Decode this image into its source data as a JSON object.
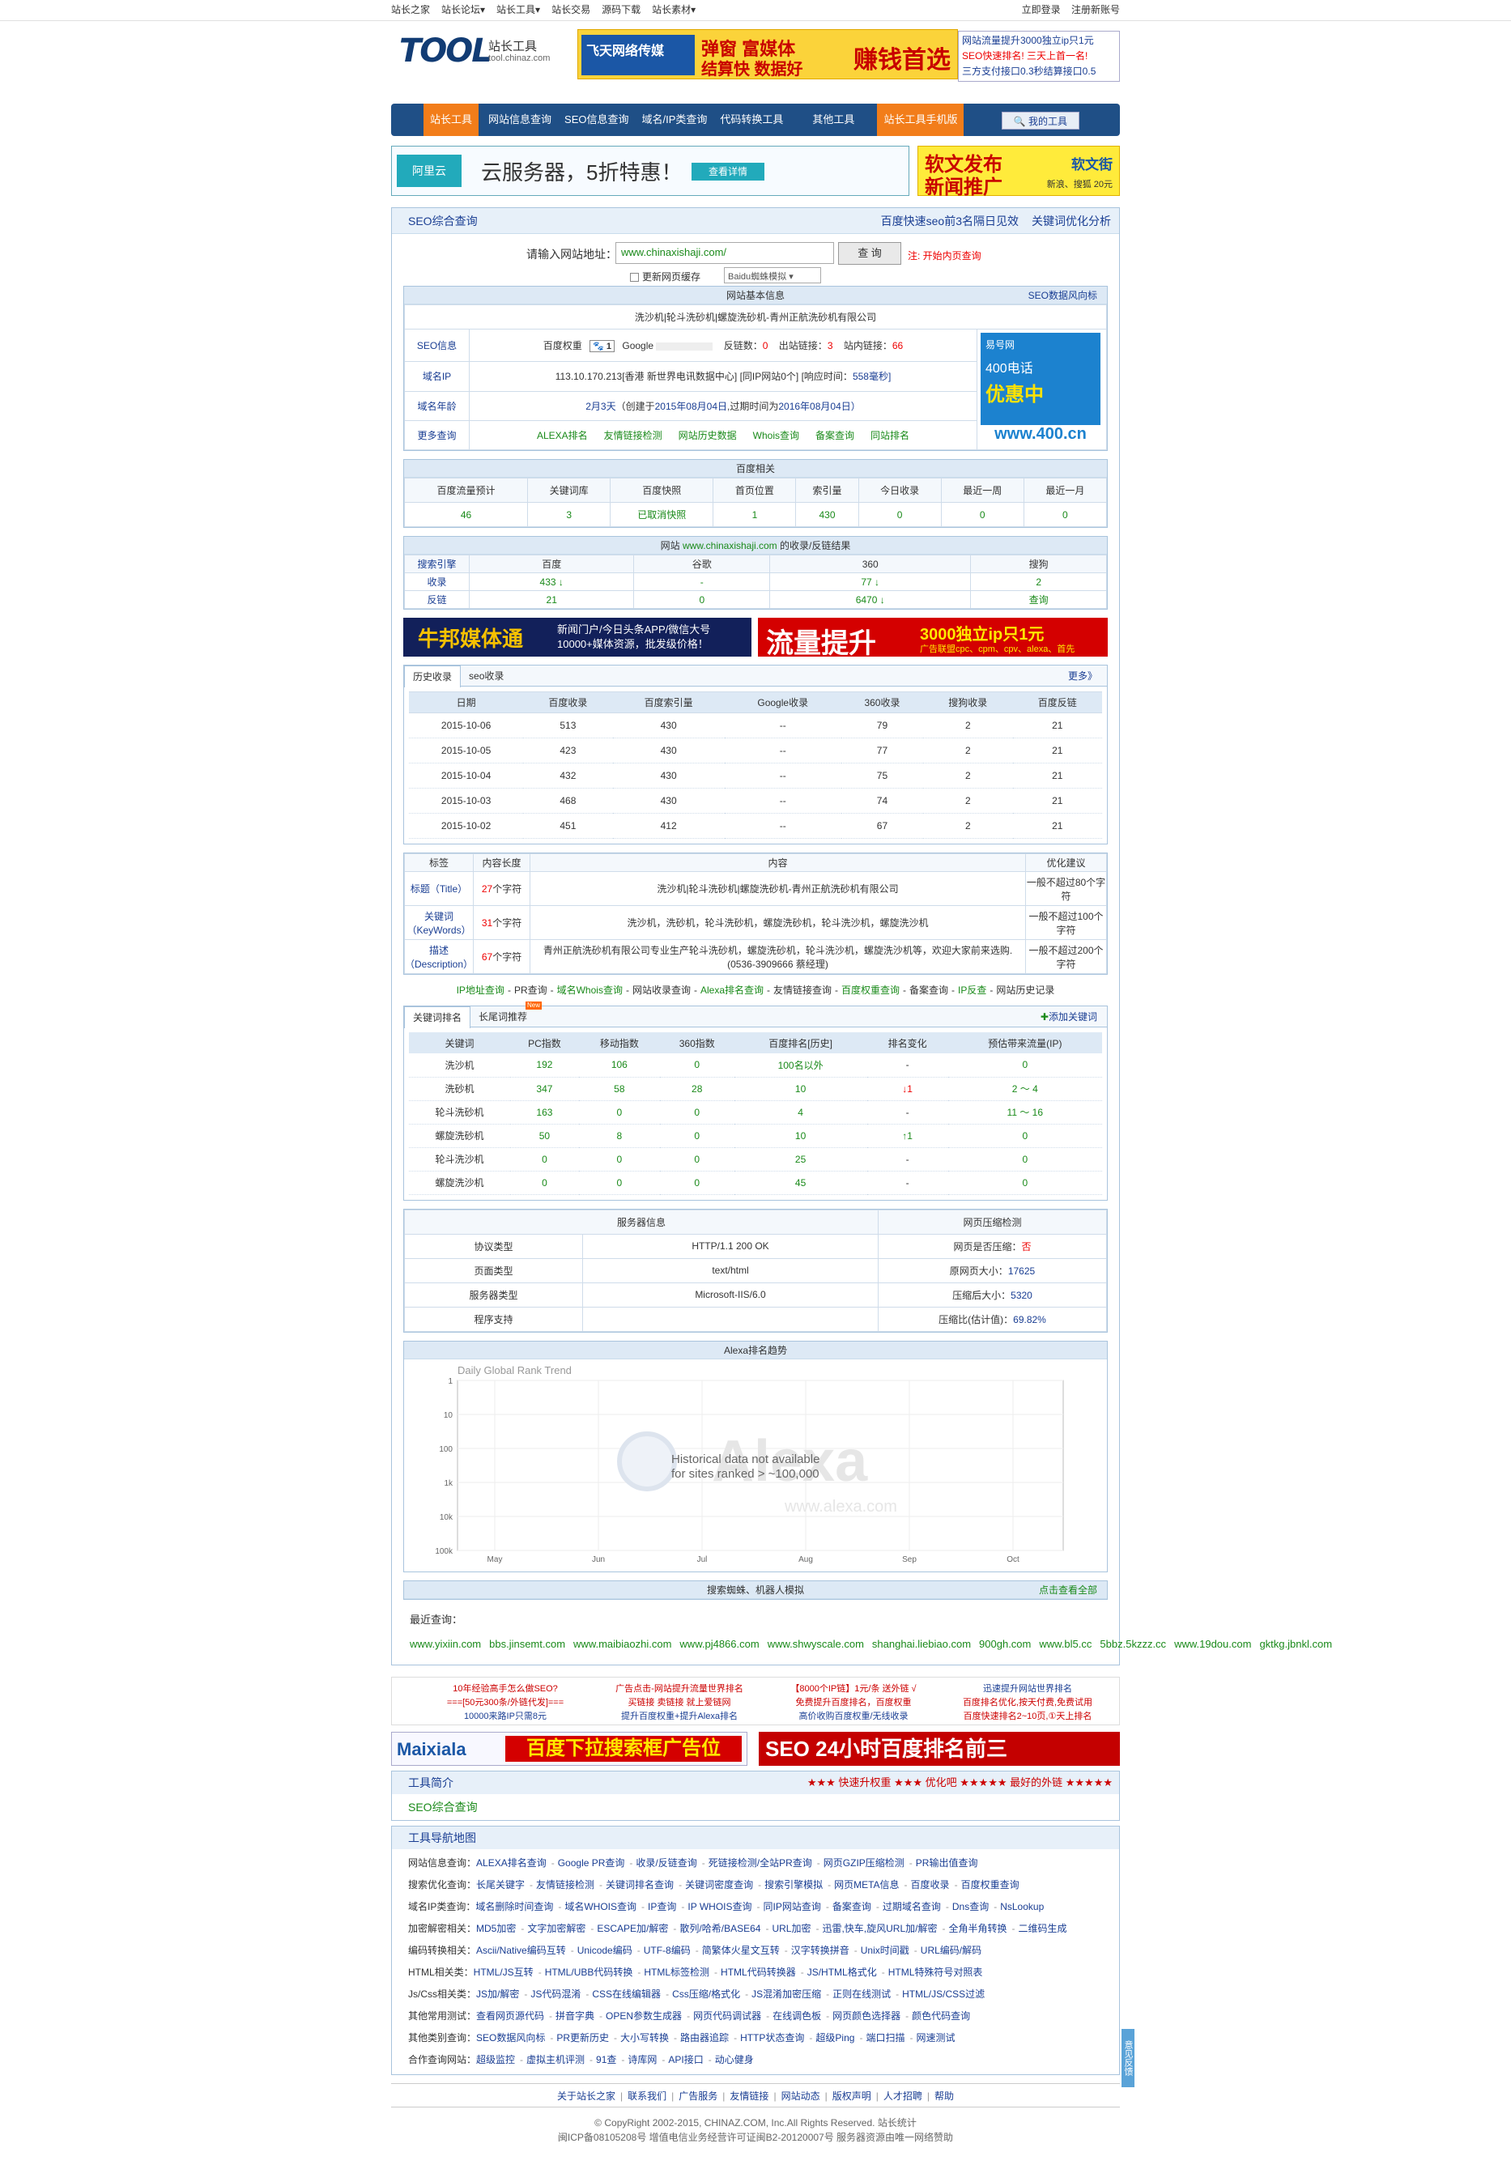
{
  "topbar": {
    "left": [
      "站长之家",
      "站长论坛▾",
      "站长工具▾",
      "站长交易",
      "源码下载",
      "站长素材▾"
    ],
    "login": "立即登录",
    "register": "注册新账号"
  },
  "logo": {
    "text": "TOOL",
    "cn": "站长工具",
    "url": "tool.chinaz.com"
  },
  "ad_top": {
    "brand": "飞天网络传媒",
    "l1": "弹窗 富媒体",
    "l2": "结算快 数据好",
    "l3": "赚钱首选"
  },
  "hot": [
    "网站流量提升3000独立ip只1元",
    "SEO快速排名! 三天上首一名!",
    "三方支付接口0.3秒结算接口0.5"
  ],
  "nav": [
    "站长工具",
    "网站信息查询",
    "SEO信息查询",
    "域名/IP类查询",
    "代码转换工具",
    "其他工具",
    "站长工具手机版"
  ],
  "nav_my": "我的工具",
  "banner_a": {
    "logo": "阿里云",
    "text": "云服务器，5折特惠！",
    "btn": "查看详情"
  },
  "banner_b": {
    "l1": "软文发布",
    "l2": "新闻推广",
    "brand": "软文街",
    "sub": "新浪、搜狐 20元"
  },
  "seo": {
    "title": "SEO综合查询",
    "r1": "百度快速seo前3名隔日见效",
    "r2": "关键词优化分析"
  },
  "search": {
    "label": "请输入网站地址：",
    "value": "www.chinaxishaji.com/",
    "button": "查 询",
    "note": "注: 开始内页查询",
    "cache": "更新网页缓存",
    "select": "Baidu蜘蛛模拟"
  },
  "basic": {
    "header": "网站基本信息",
    "risk": "SEO数据风向标",
    "site_title": "洗沙机|轮斗洗砂机|螺旋洗砂机-青州正航洗砂机有限公司",
    "seo_label": "SEO信息",
    "br_label": "百度权重",
    "br_val": "1",
    "google": "Google",
    "backlinks_l": "反链数：",
    "backlinks": "0",
    "out_l": "出站链接：",
    "out": "3",
    "in_l": "站内链接：",
    "in": "66",
    "ip_label": "域名IP",
    "ip": "113.10.170.213[香港 新世界电讯数据中心]",
    "ip_same": "[同IP网站0个]",
    "resp_l": "[响应时间：",
    "resp": "558毫秒]",
    "age_label": "域名年龄",
    "age": "2月3天",
    "age_detail_a": "（创建于",
    "created": "2015年08月04日",
    "age_detail_b": ",过期时间为",
    "expires": "2016年08月04日）",
    "more_label": "更多查询",
    "more": [
      "ALEXA排名",
      "友情链接检测",
      "网站历史数据",
      "Whois查询",
      "备案查询",
      "同站排名"
    ],
    "ad_side": {
      "brand": "易号网",
      "l1": "400电话",
      "l2": "优惠中",
      "url": "www.400.cn"
    }
  },
  "baidu": {
    "header": "百度相关",
    "cols": [
      "百度流量预计",
      "关键词库",
      "百度快照",
      "首页位置",
      "索引量",
      "今日收录",
      "最近一周",
      "最近一月"
    ],
    "vals": [
      "46",
      "3",
      "已取消快照",
      "1",
      "430",
      "0",
      "0",
      "0"
    ]
  },
  "index": {
    "header_a": "网站",
    "site": "www.chinaxishaji.com",
    "header_b": "的收录/反链结果",
    "cols": [
      "搜索引擎",
      "百度",
      "谷歌",
      "360",
      "搜狗"
    ],
    "rows": [
      [
        "收录",
        "433 ↓",
        "-",
        "77 ↓",
        "2"
      ],
      [
        "反链",
        "21",
        "0",
        "6470 ↓",
        "查询"
      ]
    ]
  },
  "ad_mid": {
    "a_t": "牛邦媒体通",
    "a_s1": "新闻门户/今日头条APP/微信大号",
    "a_s2": "10000+媒体资源，批发级价格！",
    "b_t": "流量提升",
    "b_s": "3000独立ip只1元",
    "b_s2": "广告联盟cpc、cpm、cpv、alexa、首先"
  },
  "history": {
    "tabs": [
      "历史收录",
      "seo收录"
    ],
    "more": "更多》",
    "cols": [
      "日期",
      "百度收录",
      "百度索引量",
      "Google收录",
      "360收录",
      "搜狗收录",
      "百度反链"
    ],
    "rows": [
      [
        "2015-10-06",
        "513",
        "430",
        "--",
        "79",
        "2",
        "21"
      ],
      [
        "2015-10-05",
        "423",
        "430",
        "--",
        "77",
        "2",
        "21"
      ],
      [
        "2015-10-04",
        "432",
        "430",
        "--",
        "75",
        "2",
        "21"
      ],
      [
        "2015-10-03",
        "468",
        "430",
        "--",
        "74",
        "2",
        "21"
      ],
      [
        "2015-10-02",
        "451",
        "412",
        "--",
        "67",
        "2",
        "21"
      ]
    ]
  },
  "meta": {
    "cols": [
      "标签",
      "内容长度",
      "内容",
      "优化建议"
    ],
    "rows": [
      {
        "tag": "标题（Title）",
        "len": "27",
        "unit": "个字符",
        "content": "洗沙机|轮斗洗砂机|螺旋洗砂机-青州正航洗砂机有限公司",
        "tip": "一般不超过80个字符"
      },
      {
        "tag": "关键词（KeyWords）",
        "len": "31",
        "unit": "个字符",
        "content": "洗沙机，洗砂机，轮斗洗砂机，螺旋洗砂机，轮斗洗沙机，螺旋洗沙机",
        "tip": "一般不超过100个字符"
      },
      {
        "tag": "描述（Description）",
        "len": "67",
        "unit": "个字符",
        "content": "青州正航洗砂机有限公司专业生产轮斗洗砂机，螺旋洗砂机，轮斗洗沙机，螺旋洗沙机等，欢迎大家前来选购.(0536-3909666 蔡经理)",
        "tip": "一般不超过200个字符"
      }
    ]
  },
  "qlinks": [
    "IP地址查询",
    "PR查询",
    "域名Whois查询",
    "网站收录查询",
    "Alexa排名查询",
    "友情链接查询",
    "百度权重查询",
    "备案查询",
    "IP反查",
    "网站历史记录"
  ],
  "kw": {
    "tabs": [
      "关键词排名",
      "长尾词推荐"
    ],
    "new": "New",
    "add": "添加关键词",
    "cols": [
      "关键词",
      "PC指数",
      "移动指数",
      "360指数",
      "百度排名[历史]",
      "排名变化",
      "预估带来流量(IP)"
    ],
    "rows": [
      [
        "洗沙机",
        "192",
        "106",
        "0",
        "100名以外",
        "-",
        "0"
      ],
      [
        "洗砂机",
        "347",
        "58",
        "28",
        "10",
        "↓1",
        "2 ～ 4"
      ],
      [
        "轮斗洗砂机",
        "163",
        "0",
        "0",
        "4",
        "-",
        "11 ～ 16"
      ],
      [
        "螺旋洗砂机",
        "50",
        "8",
        "0",
        "10",
        "↑1",
        "0"
      ],
      [
        "轮斗洗沙机",
        "0",
        "0",
        "0",
        "25",
        "-",
        "0"
      ],
      [
        "螺旋洗沙机",
        "0",
        "0",
        "0",
        "45",
        "-",
        "0"
      ]
    ]
  },
  "server": {
    "h1": "服务器信息",
    "h2": "网页压缩检测",
    "rows": [
      [
        "协议类型",
        "HTTP/1.1 200 OK",
        "网页是否压缩：",
        "否"
      ],
      [
        "页面类型",
        "text/html",
        "原网页大小：",
        "17625"
      ],
      [
        "服务器类型",
        "Microsoft-IIS/6.0",
        "压缩后大小：",
        "5320"
      ],
      [
        "程序支持",
        "",
        "压缩比(估计值)：",
        "69.82%"
      ]
    ]
  },
  "alexa": {
    "header": "Alexa排名趋势",
    "chart_title": "Daily Global Rank Trend",
    "msg1": "Historical data not available",
    "msg2": "for sites ranked > ~100,000",
    "wm": "Alexa",
    "wmurl": "www.alexa.com",
    "ylabels": [
      "1",
      "10",
      "100",
      "1k",
      "10k",
      "100k"
    ],
    "xlabels": [
      "May",
      "Jun",
      "Jul",
      "Aug",
      "Sep",
      "Oct"
    ]
  },
  "spider": {
    "header": "搜索蜘蛛、机器人模拟",
    "more": "点击查看全部"
  },
  "recent": {
    "label": "最近查询：",
    "items": [
      "www.yixiin.com",
      "bbs.jinsemt.com",
      "www.maibiaozhi.com",
      "www.pj4866.com",
      "www.shwyscale.com",
      "shanghai.liebiao.com",
      "900gh.com",
      "www.bl5.cc",
      "5bbz.5kzzz.cc",
      "www.19dou.com",
      "gktkg.jbnkl.com"
    ]
  },
  "adtxt": [
    [
      "10年经验高手怎么做SEO?",
      "===[50元300条/外链代发]===",
      "10000来路IP只需8元"
    ],
    [
      "广告点击-网站提升流量世界排名",
      "买链接 卖链接 就上爱链网",
      "提升百度权重+提升Alexa排名"
    ],
    [
      "【8000个IP链】1元/条 送外链 √",
      "免费提升百度排名，百度权重",
      "高价收购百度权重/无线收录"
    ],
    [
      "迅速提升网站世界排名",
      "百度排名优化,按天付费,免费试用",
      "百度快速排名2~10页,①天上排名"
    ]
  ],
  "ad_bot": {
    "a_l": "Maixiala",
    "a_m": "百度下拉搜索框广告位",
    "b": "SEO 24小时百度排名前三"
  },
  "intro": {
    "title": "工具简介",
    "r": "★★★ 快速升权重 ★★★ 优化吧   ★★★★★ 最好的外链 ★★★★★",
    "body": "SEO综合查询"
  },
  "sitemap": {
    "title": "工具导航地图",
    "rows": [
      {
        "k": "网站信息查询：",
        "v": [
          "ALEXA排名查询",
          "Google PR查询",
          "收录/反链查询",
          "死链接检测/全站PR查询",
          "网页GZIP压缩检测",
          "PR输出值查询"
        ]
      },
      {
        "k": "搜索优化查询：",
        "v": [
          "长尾关键字",
          "友情链接检测",
          "关键词排名查询",
          "关键词密度查询",
          "搜索引擎模拟",
          "网页META信息",
          "百度收录",
          "百度权重查询"
        ]
      },
      {
        "k": "域名IP类查询：",
        "v": [
          "域名删除时间查询",
          "域名WHOIS查询",
          "IP查询",
          "IP WHOIS查询",
          "同IP网站查询",
          "备案查询",
          "过期域名查询",
          "Dns查询",
          "NsLookup"
        ]
      },
      {
        "k": "加密解密相关：",
        "v": [
          "MD5加密",
          "文字加密解密",
          "ESCAPE加/解密",
          "散列/哈希/BASE64",
          "URL加密",
          "迅雷,快车,旋风URL加/解密",
          "全角半角转换",
          "二维码生成"
        ]
      },
      {
        "k": "编码转换相关：",
        "v": [
          "Ascii/Native编码互转",
          "Unicode编码",
          "UTF-8编码",
          "简繁体火星文互转",
          "汉字转换拼音",
          "Unix时间戳",
          "URL编码/解码"
        ]
      },
      {
        "k": "HTML相关类：",
        "v": [
          "HTML/JS互转",
          "HTML/UBB代码转换",
          "HTML标签检测",
          "HTML代码转换器",
          "JS/HTML格式化",
          "HTML特殊符号对照表"
        ]
      },
      {
        "k": "Js/Css相关类：",
        "v": [
          "JS加/解密",
          "JS代码混淆",
          "CSS在线编辑器",
          "Css压缩/格式化",
          "JS混淆加密压缩",
          "正则在线测试",
          "HTML/JS/CSS过滤"
        ]
      },
      {
        "k": "其他常用测试：",
        "v": [
          "查看网页源代码",
          "拼音字典",
          "OPEN参数生成器",
          "网页代码调试器",
          "在线调色板",
          "网页颜色选择器",
          "颜色代码查询"
        ]
      },
      {
        "k": "其他类别查询：",
        "v": [
          "SEO数据风向标",
          "PR更新历史",
          "大小写转换",
          "路由器追踪",
          "HTTP状态查询",
          "超级Ping",
          "端口扫描",
          "网速测试"
        ]
      },
      {
        "k": "合作查询网站：",
        "v": [
          "超级监控",
          "虚拟主机评测",
          "91查",
          "诗库网",
          "API接口",
          "动心健身"
        ]
      }
    ]
  },
  "footer": [
    "关于站长之家",
    "联系我们",
    "广告服务",
    "友情链接",
    "网站动态",
    "版权声明",
    "人才招聘",
    "帮助"
  ],
  "copy1": "© CopyRight 2002-2015, CHINAZ.COM, Inc.All Rights Reserved. 站长统计",
  "copy2": "闽ICP备08105208号  增值电信业务经营许可证闽B2-20120007号  服务器资源由唯一网络赞助",
  "sidebar": "意见反馈"
}
